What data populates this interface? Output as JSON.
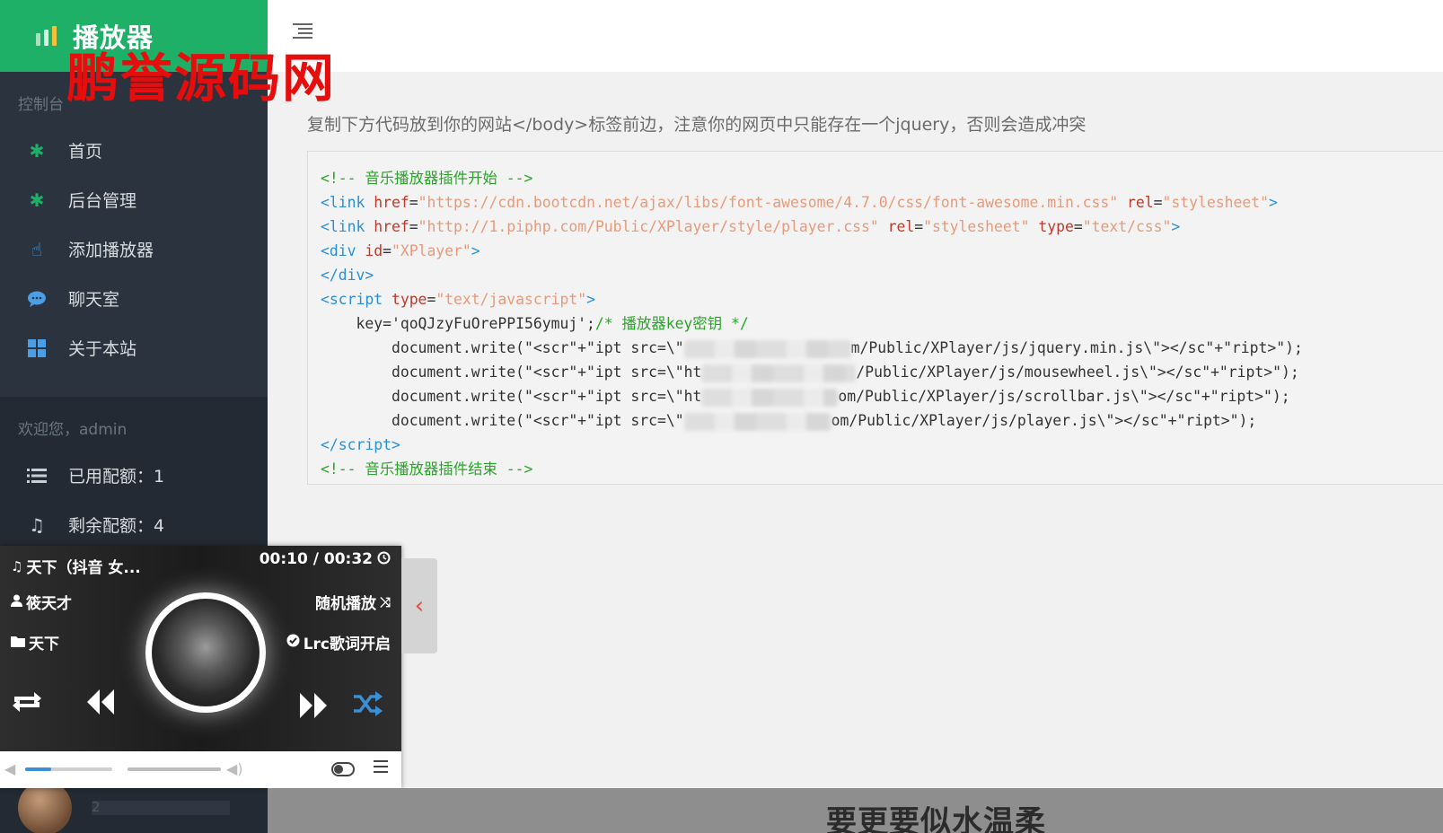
{
  "app": {
    "title": "播放器",
    "watermark": "鹏誉源码网"
  },
  "sidebar": {
    "console_title": "控制台",
    "items": [
      {
        "label": "首页",
        "icon": "asterisk-icon"
      },
      {
        "label": "后台管理",
        "icon": "asterisk-icon"
      },
      {
        "label": "添加播放器",
        "icon": "thumbs-up-icon"
      },
      {
        "label": "聊天室",
        "icon": "comment-icon"
      },
      {
        "label": "关于本站",
        "icon": "grid-icon"
      }
    ],
    "welcome": "欢迎您，admin",
    "quota": [
      {
        "label": "已用配额：1",
        "icon": "list-icon"
      },
      {
        "label": "剩余配额：4",
        "icon": "music-icon"
      }
    ],
    "user": {
      "name": "admin",
      "id_prefix": "2"
    }
  },
  "main": {
    "intro": "复制下方代码放到你的网站</body>标签前边，注意你的网页中只能存在一个jquery，否则会造成冲突",
    "code": {
      "comment_start": "<!-- 音乐播放器插件开始 -->",
      "link1_href": "\"https://cdn.bootcdn.net/ajax/libs/font-awesome/4.7.0/css/font-awesome.min.css\"",
      "link1_rel": "\"stylesheet\"",
      "link2_href": "\"http://1.piphp.com/Public/XPlayer/style/player.css\"",
      "link2_rel": "\"stylesheet\"",
      "link2_type": "\"text/css\"",
      "div_id": "\"XPlayer\"",
      "script_type": "\"text/javascript\"",
      "key_line": "key='qoQJzyFuOrePPI56ymuj';",
      "key_comment": "/* 播放器key密钥 */",
      "write1_pre": "document.write(\"<scr\"+\"ipt src=\\\"",
      "write1_post": "m/Public/XPlayer/js/jquery.min.js\\\"></sc\"+\"ript>\");",
      "write2_pre": "document.write(\"<scr\"+\"ipt src=\\\"ht",
      "write2_post": "/Public/XPlayer/js/mousewheel.js\\\"></sc\"+\"ript>\");",
      "write3_pre": "document.write(\"<scr\"+\"ipt src=\\\"ht",
      "write3_post": "om/Public/XPlayer/js/scrollbar.js\\\"></sc\"+\"ript>\");",
      "write4_pre": "document.write(\"<scr\"+\"ipt src=\\\"",
      "write4_post": "om/Public/XPlayer/js/player.js\\\"></sc\"+\"ript>\");",
      "comment_end": "<!-- 音乐播放器插件结束 -->"
    }
  },
  "player": {
    "song": "天下（抖音 女...",
    "artist": "筱天才",
    "album": "天下",
    "time": "00:10 / 00:32",
    "mode": "随机播放",
    "lrc": "Lrc歌词开启",
    "progress": 0.3,
    "volume": 1.0,
    "lyric": "要更要似水温柔",
    "colors": {
      "accent": "#1fb068",
      "progress": "#3b8fd6",
      "tab_arrow": "#e0503a"
    }
  }
}
